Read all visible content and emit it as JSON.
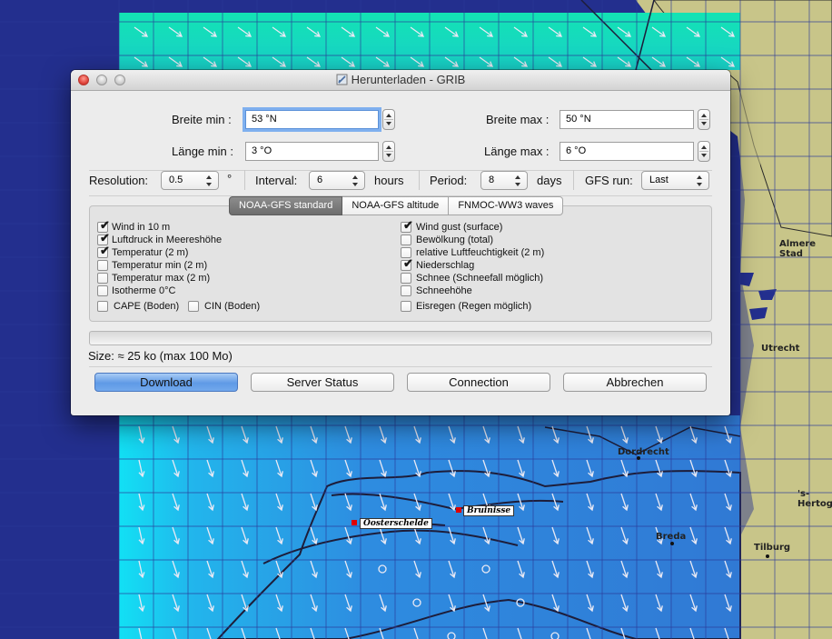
{
  "window": {
    "title": "Herunterladen - GRIB"
  },
  "bounds": {
    "lat_min_label": "Breite min :",
    "lat_min_value": "53 °N",
    "lat_max_label": "Breite max :",
    "lat_max_value": "50 °N",
    "lon_min_label": "Länge min :",
    "lon_min_value": "3 °O",
    "lon_max_label": "Länge max :",
    "lon_max_value": "6 °O"
  },
  "params": {
    "resolution_label": "Resolution:",
    "resolution_value": "0.5",
    "resolution_unit": "°",
    "interval_label": "Interval:",
    "interval_value": "6",
    "interval_unit": "hours",
    "period_label": "Period:",
    "period_value": "8",
    "period_unit": "days",
    "gfs_run_label": "GFS run:",
    "gfs_run_value": "Last"
  },
  "tabs": [
    {
      "label": "NOAA-GFS standard",
      "active": true
    },
    {
      "label": "NOAA-GFS altitude",
      "active": false
    },
    {
      "label": "FNMOC-WW3 waves",
      "active": false
    }
  ],
  "options_left": [
    {
      "label": "Wind in 10 m",
      "checked": true
    },
    {
      "label": "Luftdruck in Meereshöhe",
      "checked": true
    },
    {
      "label": "Temperatur (2 m)",
      "checked": true
    },
    {
      "label": "Temperatur min  (2 m)",
      "checked": false
    },
    {
      "label": "Temperatur max (2 m)",
      "checked": false
    },
    {
      "label": "Isotherme 0°C",
      "checked": false
    }
  ],
  "cape": {
    "label": "CAPE (Boden)",
    "checked": false
  },
  "cin": {
    "label": "CIN (Boden)",
    "checked": false
  },
  "options_right": [
    {
      "label": "Wind gust (surface)",
      "checked": true
    },
    {
      "label": "Bewölkung (total)",
      "checked": false
    },
    {
      "label": "relative Luftfeuchtigkeit (2 m)",
      "checked": false
    },
    {
      "label": "Niederschlag",
      "checked": true
    },
    {
      "label": "Schnee (Schneefall möglich)",
      "checked": false
    },
    {
      "label": "Schneehöhe",
      "checked": false
    },
    {
      "label": "Eisregen (Regen möglich)",
      "checked": false
    }
  ],
  "size_text": "Size: ≈ 25 ko (max 100 Mo)",
  "buttons": {
    "download": "Download",
    "server_status": "Server Status",
    "connection": "Connection",
    "cancel": "Abbrechen"
  },
  "map": {
    "places": {
      "oosterschelde": "Oosterschelde",
      "bruinisse": "Bruinisse"
    },
    "cities": {
      "almere": "Almere Stad",
      "utrecht": "Utrecht",
      "dordrecht": "Dordrecht",
      "hertogenbosch": "'s-Hertog",
      "breda": "Breda",
      "tilburg": "Tilburg"
    },
    "colors": {
      "sea": "#232f8e",
      "land": "#c8c589",
      "grib_shallow": "#1fd8f0",
      "grib_deep": "#2f7fd8"
    }
  }
}
